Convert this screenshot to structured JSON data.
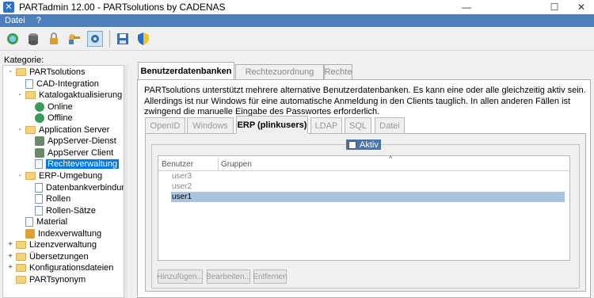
{
  "window": {
    "title": "PARTadmin 12.00 - PARTsolutions by CADENAS",
    "minimize": "—",
    "maximize": "☐",
    "close": "✕"
  },
  "menu": [
    "Datei",
    "?"
  ],
  "toolbar": [
    "refresh-icon",
    "database-icon",
    "lock-icon",
    "key-icon",
    "gear-icon",
    "save-icon",
    "shield-icon"
  ],
  "sidebar": {
    "label": "Kategorie:",
    "tree": [
      {
        "label": "PARTsolutions",
        "level": 0,
        "icon": "folder",
        "expand": "-"
      },
      {
        "label": "CAD-Integration",
        "level": 1,
        "icon": "page",
        "expand": ""
      },
      {
        "label": "Katalogaktualisierung",
        "level": 1,
        "icon": "folder",
        "expand": "-"
      },
      {
        "label": "Online",
        "level": 2,
        "icon": "globe",
        "expand": ""
      },
      {
        "label": "Offline",
        "level": 2,
        "icon": "globe",
        "expand": ""
      },
      {
        "label": "Application Server",
        "level": 1,
        "icon": "folder",
        "expand": "-"
      },
      {
        "label": "AppServer-Dienst",
        "level": 2,
        "icon": "server",
        "expand": ""
      },
      {
        "label": "AppServer Client",
        "level": 2,
        "icon": "server",
        "expand": ""
      },
      {
        "label": "Rechteverwaltung",
        "level": 2,
        "icon": "page",
        "expand": "",
        "selected": true
      },
      {
        "label": "ERP-Umgebung",
        "level": 1,
        "icon": "folder",
        "expand": "-"
      },
      {
        "label": "Datenbankverbindung",
        "level": 2,
        "icon": "page",
        "expand": ""
      },
      {
        "label": "Rollen",
        "level": 2,
        "icon": "page",
        "expand": ""
      },
      {
        "label": "Rollen-Sätze",
        "level": 2,
        "icon": "page",
        "expand": ""
      },
      {
        "label": "Material",
        "level": 1,
        "icon": "page",
        "expand": ""
      },
      {
        "label": "Indexverwaltung",
        "level": 1,
        "icon": "index",
        "expand": ""
      },
      {
        "label": "Lizenzverwaltung",
        "level": 0,
        "icon": "folder",
        "expand": "+"
      },
      {
        "label": "Übersetzungen",
        "level": 0,
        "icon": "folder",
        "expand": "+"
      },
      {
        "label": "Konfigurationsdateien",
        "level": 0,
        "icon": "folder",
        "expand": "+"
      },
      {
        "label": "PARTsynonym",
        "level": 0,
        "icon": "folder",
        "expand": ""
      }
    ]
  },
  "main": {
    "tabs": [
      "Benutzerdatenbanken",
      "Rechtezuordnung",
      "Rechte"
    ],
    "description": "PARTsolutions unterstützt mehrere alternative Benutzerdatenbanken. Es kann eine oder alle gleichzeitig aktiv sein. Allerdings ist nur Windows für eine automatische Anmeldung in den Clients tauglich. In allen anderen Fällen ist zwingend die manuelle Eingabe des Passwortes erforderlich.",
    "subtabs": [
      "OpenID",
      "Windows",
      "ERP (plinkusers)",
      "LDAP",
      "SQL",
      "Datei"
    ],
    "aktiv_label": "Aktiv",
    "table": {
      "headers": [
        "Benutzer",
        "Gruppen"
      ],
      "sort_indicator": "^",
      "rows": [
        "user3",
        "user2",
        "user1"
      ]
    },
    "buttons": [
      "Hinzufügen...",
      "Bearbeiten...",
      "Entfernen"
    ]
  }
}
